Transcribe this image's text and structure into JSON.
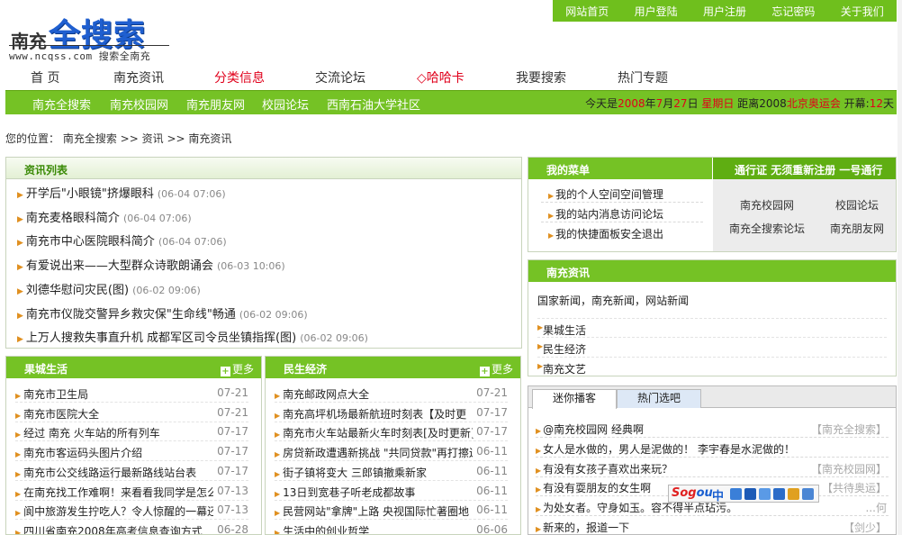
{
  "top_links": [
    "网站首页",
    "用户登陆",
    "用户注册",
    "忘记密码",
    "关于我们"
  ],
  "logo": {
    "prefix": "南充",
    "main": "全搜索",
    "url_text": "www.ncqss.com 搜索全南充"
  },
  "main_nav": [
    "首 页",
    "南充资讯",
    "分类信息",
    "交流论坛",
    "◇哈哈卡",
    "我要搜索",
    "热门专题"
  ],
  "sub_nav": [
    "南充全搜索",
    "南充校园网",
    "南充朋友网",
    "校园论坛",
    "西南石油大学社区"
  ],
  "today": {
    "label": "今天是",
    "year": "2008",
    "y_unit": "年",
    "month": "7",
    "m_unit": "月",
    "day": "27",
    "d_unit": "日",
    "weekday": "星期日",
    "countdown_label": "距离2008",
    "olympics": "北京奥运会",
    "open_label": "开幕:",
    "days": "12",
    "days_unit": "天"
  },
  "breadcrumb": {
    "label": "您的位置：",
    "path": [
      "南充全搜索",
      "资讯",
      "南充资讯"
    ],
    "sep": " >> "
  },
  "news_list": {
    "title": "资讯列表",
    "items": [
      {
        "title": "开学后\"小眼镜\"挤爆眼科",
        "date": "(06-04 07:06)"
      },
      {
        "title": "南充麦格眼科简介",
        "date": "(06-04 07:06)"
      },
      {
        "title": "南充市中心医院眼科简介",
        "date": "(06-04 07:06)"
      },
      {
        "title": "有爱说出来——大型群众诗歌朗诵会",
        "date": "(06-03 10:06)"
      },
      {
        "title": "刘德华慰问灾民(图)",
        "date": "(06-02 09:06)"
      },
      {
        "title": "南充市仪陇交警异乡救灾保\"生命线\"畅通",
        "date": "(06-02 09:06)"
      },
      {
        "title": "上万人搜救失事直升机 成都军区司令员坐镇指挥(图)",
        "date": "(06-02 09:06)"
      }
    ]
  },
  "guocheng": {
    "title": "果城生活",
    "more": "更多",
    "items": [
      {
        "title": "南充市卫生局",
        "date": "07-21"
      },
      {
        "title": "南充市医院大全",
        "date": "07-21"
      },
      {
        "title": "经过 南充 火车站的所有列车",
        "date": "07-17"
      },
      {
        "title": "南充市客运码头图片介绍",
        "date": "07-17"
      },
      {
        "title": "南充市公交线路运行最新路线站台表",
        "date": "07-17"
      },
      {
        "title": "在南充找工作难啊！来看看我同学是怎么",
        "date": "07-13"
      },
      {
        "title": "阆中旅游发生拧吃人？令人惊醒的一幕还",
        "date": "07-13"
      },
      {
        "title": "四川省南充2008年高考信息查询方式",
        "date": "06-28"
      }
    ]
  },
  "minsheng": {
    "title": "民生经济",
    "more": "更多",
    "items": [
      {
        "title": "南充邮政网点大全",
        "date": "07-21"
      },
      {
        "title": "南充高坪机场最新航班时刻表【及时更",
        "date": "07-17"
      },
      {
        "title": "南充市火车站最新火车时刻表[及时更新]",
        "date": "07-17"
      },
      {
        "title": "房贷新政遭遇新挑战 \"共同贷款\"再打擦边",
        "date": "06-11"
      },
      {
        "title": "街子镇将变大 三郎镇撤乘新家",
        "date": "06-11"
      },
      {
        "title": "13日到宽巷子听老成都故事",
        "date": "06-11"
      },
      {
        "title": "民营网站\"拿牌\"上路 央视国际忙著圈地",
        "date": "06-11"
      },
      {
        "title": "生活中的创业哲学",
        "date": "06-06"
      }
    ]
  },
  "my_menu": {
    "title": "我的菜单",
    "rows": [
      [
        "我的个人空间",
        "空间管理"
      ],
      [
        "我的站内消息",
        "访问论坛"
      ],
      [
        "我的快捷面板",
        "安全退出"
      ]
    ]
  },
  "passport": {
    "title": "通行证",
    "subtitle": "无须重新注册 一号通行",
    "links": [
      "南充校园网",
      "校园论坛",
      "南充全搜索论坛",
      "南充朋友网"
    ]
  },
  "nc_info": {
    "title": "南充资讯",
    "links": [
      "国家新闻",
      "南充新闻",
      "网站新闻"
    ],
    "sep": "，",
    "items": [
      "果城生活",
      "民生经济",
      "南充文艺"
    ]
  },
  "tabs": {
    "labels": [
      "迷你播客",
      "热门选吧"
    ],
    "items": [
      {
        "title": "@南充校园网 经典啊",
        "src": "【南充全搜索】"
      },
      {
        "title": "女人是水做的，男人是泥做的！ 李宇春是水泥做的！",
        "src": ""
      },
      {
        "title": "有没有女孩子喜欢出来玩？",
        "src": "【南充校园网】"
      },
      {
        "title": "有没有耍朋友的女生啊",
        "src": "【共待奥运】"
      },
      {
        "title": "为处女者。守身如玉。容不得半点玷污。",
        "src": "...何"
      },
      {
        "title": "新来的，报道一下",
        "src": "【剑少】"
      }
    ]
  },
  "sogou": {
    "logo_a": "Sog",
    "logo_b": "ou",
    "mode": "中"
  }
}
